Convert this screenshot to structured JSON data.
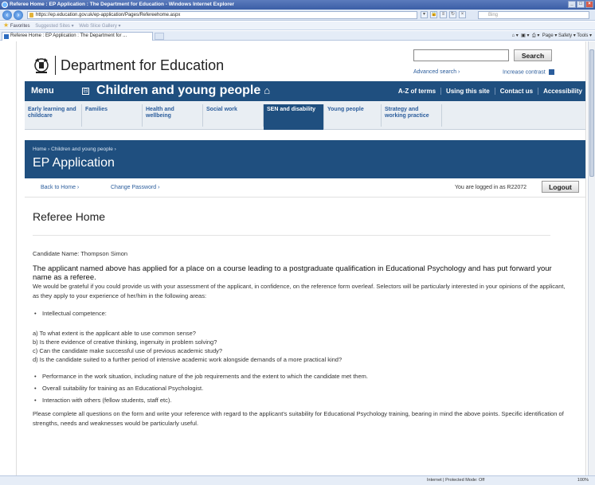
{
  "browser": {
    "title": "Referee Home : EP Application : The Department for Education - Windows Internet Explorer",
    "url": "https://ep.education.gov.uk/ep-application/Pages/Refereehome.aspx",
    "search_placeholder": "Bing",
    "favorites": {
      "label": "Favorites",
      "suggested": "Suggested Sites ▾",
      "slice": "Web Slice Gallery ▾"
    },
    "tab_title": "Referee Home : EP Application : The Department for ...",
    "commands": "Page ▾   Safety ▾   Tools ▾",
    "status_zone": "Internet | Protected Mode: Off",
    "zoom": "100%"
  },
  "header": {
    "department": "Department for Education",
    "search_button": "Search",
    "advanced_search": "Advanced search ›",
    "increase_contrast": "Increase contrast"
  },
  "nav": {
    "menu": "Menu",
    "menu_toggle": "⊟",
    "section": "Children and young people",
    "links": [
      "A-Z of terms",
      "Using this site",
      "Contact us",
      "Accessibility"
    ]
  },
  "subnav": [
    "Early learning and childcare",
    "Families",
    "Health and wellbeing",
    "Social work",
    "SEN and disability",
    "Young people",
    "Strategy and working practice"
  ],
  "banner": {
    "breadcrumb": "Home ›  Children and young people ›",
    "title": "EP Application"
  },
  "actions": {
    "back_home": "Back to Home ›",
    "change_password": "Change Password ›",
    "logged_in": "You are logged in as R22072",
    "logout": "Logout"
  },
  "content": {
    "heading": "Referee Home",
    "candidate": "Candidate Name: Thompson Simon",
    "intro": "The applicant named above has applied for a place on a course leading to a postgraduate qualification in Educational Psychology and has put forward your name as a referee.",
    "para1": "We would be grateful if you could provide us with your assessment of the applicant, in confidence, on the reference form overleaf. Selectors will be particularly interested in your opinions of the applicant, as they apply to your experience of her/him in the following areas:",
    "bullet_intellectual": "Intellectual competence:",
    "questions": [
      "a) To what extent is the applicant able to use common sense?",
      "b) Is there evidence of creative thinking, ingenuity in problem solving?",
      "c) Can the candidate make successful use of previous academic study?",
      "d) Is the candidate suited to a further period of intensive academic work alongside demands of a more practical kind?"
    ],
    "bullets": [
      "Performance in the work situation, including nature of the job requirements and the extent to which the candidate met them.",
      "Overall suitability for training as an Educational Psychologist.",
      "Interaction with others (fellow students, staff etc)."
    ],
    "closing": "Please complete all questions on the form and write your reference with regard to the applicant's suitability for Educational Psychology training, bearing in mind the above points. Specific identification of strengths, needs and weaknesses would be particularly useful."
  }
}
